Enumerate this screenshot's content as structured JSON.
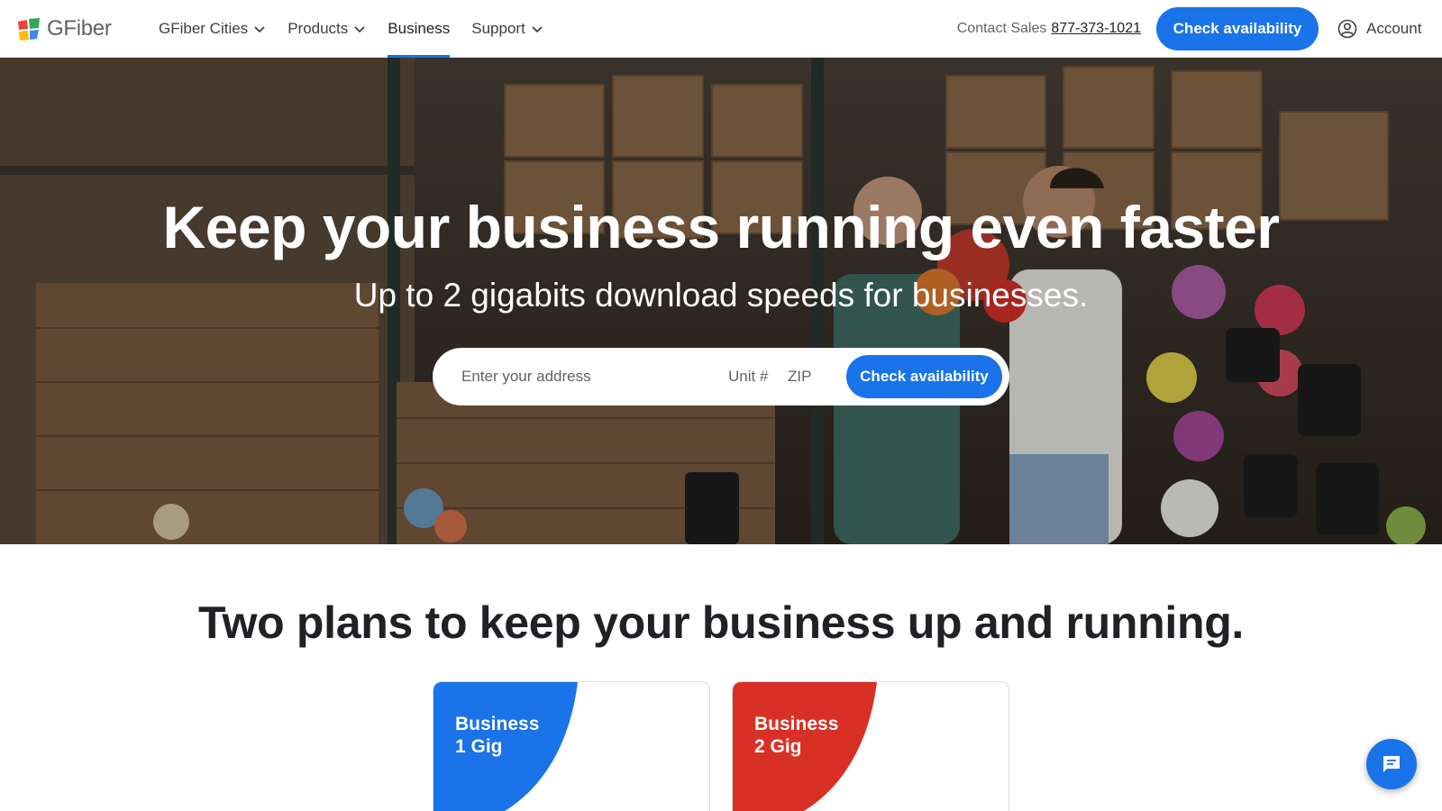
{
  "header": {
    "logo_text": "GFiber",
    "nav": [
      {
        "label": "GFiber Cities",
        "has_dropdown": true
      },
      {
        "label": "Products",
        "has_dropdown": true
      },
      {
        "label": "Business",
        "has_dropdown": false,
        "active": true
      },
      {
        "label": "Support",
        "has_dropdown": true
      }
    ],
    "contact_label": "Contact Sales",
    "contact_phone": "877-373-1021",
    "cta_label": "Check availability",
    "account_label": "Account"
  },
  "hero": {
    "title": "Keep your business running even faster",
    "subtitle": "Up to 2 gigabits download speeds for businesses.",
    "address_placeholder": "Enter your address",
    "unit_placeholder": "Unit #",
    "zip_placeholder": "ZIP",
    "button_label": "Check availability"
  },
  "plans": {
    "title": "Two plans to keep your business up and running.",
    "cards": [
      {
        "line1": "Business",
        "line2": "1 Gig",
        "color": "#1a73e8"
      },
      {
        "line1": "Business",
        "line2": "2 Gig",
        "color": "#d93025"
      }
    ]
  },
  "colors": {
    "accent": "#1a73e8",
    "plan_red": "#d93025"
  },
  "icons": {
    "logo": "gfiber-logo-icon",
    "dropdown": "chevron-down-icon",
    "account": "account-circle-icon",
    "chat": "chat-icon"
  }
}
